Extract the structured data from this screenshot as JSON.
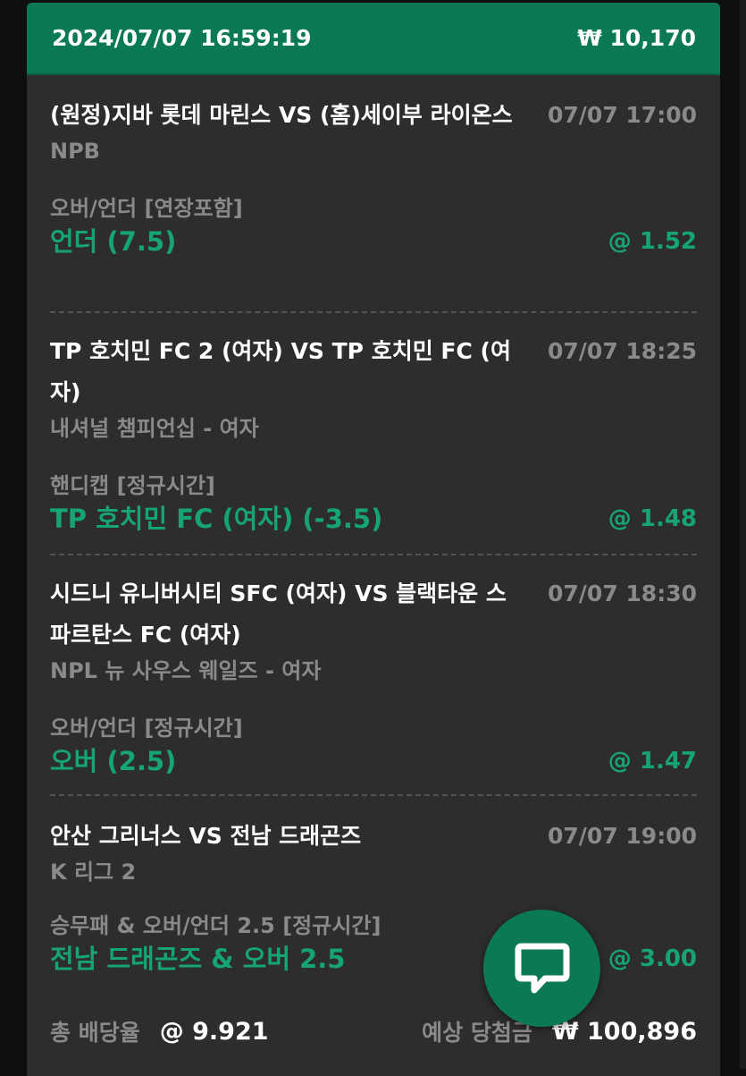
{
  "header": {
    "datetime": "2024/07/07 16:59:19",
    "amount": "₩ 10,170"
  },
  "bets": [
    {
      "match": "(원정)지바 롯데 마린스 VS (홈)세이부 라이온스",
      "time": "07/07 17:00",
      "league": "NPB",
      "market": "오버/언더 [연장포함]",
      "pick": "언더 (7.5)",
      "odds": "@ 1.52"
    },
    {
      "match": "TP 호치민 FC 2 (여자) VS TP 호치민 FC (여자)",
      "time": "07/07 18:25",
      "league": "내셔널 챔피언십 - 여자",
      "market": "핸디캡 [정규시간]",
      "pick": "TP 호치민 FC (여자) (-3.5)",
      "odds": "@ 1.48"
    },
    {
      "match": "시드니 유니버시티 SFC (여자) VS 블랙타운 스파르탄스 FC (여자)",
      "time": "07/07 18:30",
      "league": "NPL 뉴 사우스 웨일즈 - 여자",
      "market": "오버/언더 [정규시간]",
      "pick": "오버 (2.5)",
      "odds": "@ 1.47"
    },
    {
      "match": "안산 그리너스 VS 전남 드래곤즈",
      "time": "07/07 19:00",
      "league": "K 리그 2",
      "market": "승무패 & 오버/언더 2.5 [정규시간]",
      "pick": "전남 드래곤즈 & 오버 2.5",
      "odds": "@ 3.00"
    }
  ],
  "footer": {
    "total_odds_label": "총 배당율",
    "total_odds_value": "@ 9.921",
    "expected_win_label": "예상 당첨금",
    "expected_win_value": "₩ 100,896"
  },
  "icons": {
    "chat": "chat-bubble-icon"
  },
  "colors": {
    "accent": "#0b7a52",
    "pick_green": "#16a472",
    "card_bg": "#2d2d2d"
  }
}
